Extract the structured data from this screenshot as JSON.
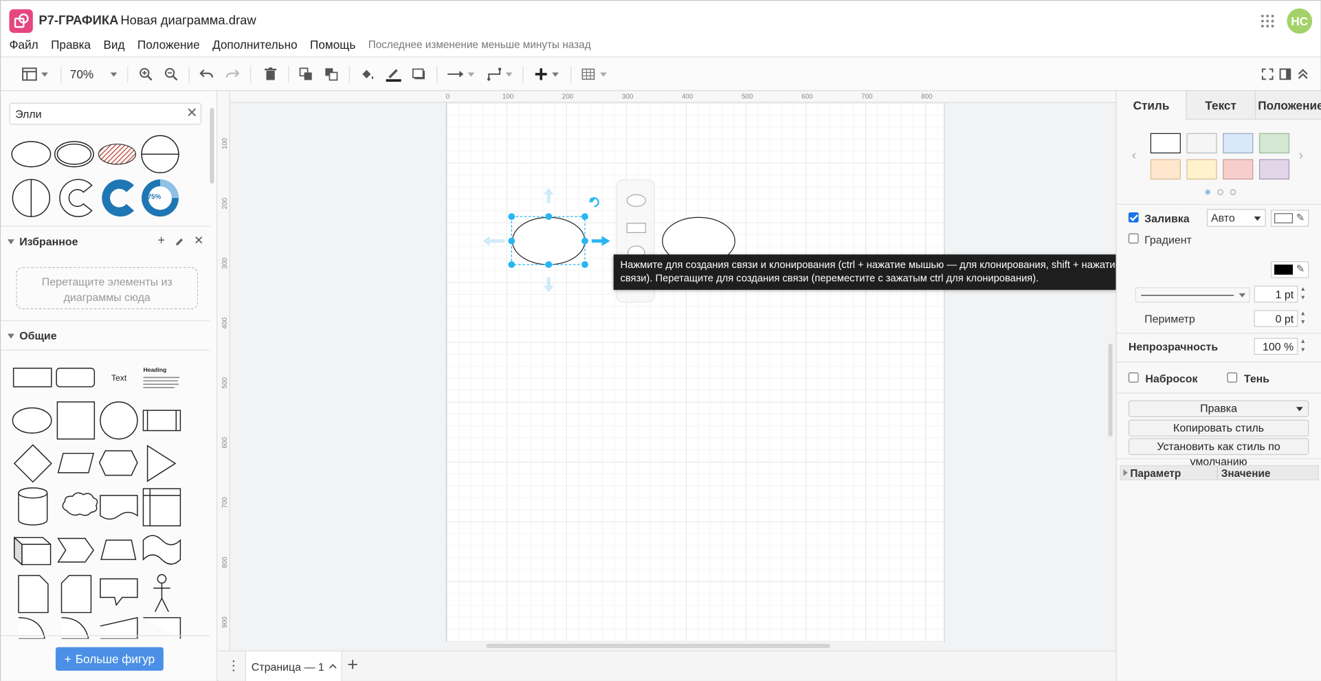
{
  "app": {
    "name": "Р7-ГРАФИКА",
    "document_title": "Новая диаграмма.draw",
    "avatar_initials": "НС",
    "logo_color": "#e6457f",
    "avatar_color": "#a4d26a"
  },
  "menu": {
    "items": [
      "Файл",
      "Правка",
      "Вид",
      "Положение",
      "Дополнительно",
      "Помощь"
    ],
    "last_change": "Последнее изменение меньше минуты назад"
  },
  "toolbar": {
    "zoom": "70%",
    "icons": [
      "panel-layout-icon",
      "zoom-in-icon",
      "zoom-out-icon",
      "undo-icon",
      "redo-icon",
      "delete-icon",
      "to-front-icon",
      "to-back-icon",
      "fill-color-icon",
      "line-color-icon",
      "shadow-icon",
      "connection-icon",
      "waypoints-icon",
      "insert-icon",
      "table-icon",
      "fullscreen-icon",
      "format-panel-icon",
      "collapse-icon"
    ]
  },
  "left": {
    "search_value": "Элли",
    "favorites_title": "Избранное",
    "favorites_drop": "Перетащите элементы из диаграммы сюда",
    "general_title": "Общие",
    "shape_text": "Text",
    "shape_heading": "Heading",
    "donut_label": "75%",
    "more_shapes": "Больше фигур"
  },
  "canvas": {
    "ruler_top": [
      "0",
      "100",
      "200",
      "300",
      "400",
      "500",
      "600",
      "700",
      "800"
    ],
    "ruler_left": [
      "100",
      "200",
      "300",
      "400",
      "500",
      "600",
      "700",
      "800",
      "900"
    ],
    "tooltip": "Нажмите для создания связи и клонирования (ctrl + нажатие мышью — для клонирования, shift + нажатие мышью — для создания связи). Перетащите для создания связи (переместите с зажатым ctrl для клонирования).",
    "selection_color": "#29b6f2"
  },
  "bottom": {
    "page_tab": "Страница — 1"
  },
  "right": {
    "tabs": [
      "Стиль",
      "Текст",
      "Положение"
    ],
    "swatches": [
      "#ffffff",
      "#f5f5f5",
      "#dae8fc",
      "#d5e8d4",
      "#ffe6cc",
      "#fff2cc",
      "#f8cecc",
      "#e1d5e7"
    ],
    "fill_label": "Заливка",
    "fill_mode": "Авто",
    "gradient_label": "Градиент",
    "line_width": "1 pt",
    "perimeter_label": "Периметр",
    "perimeter_value": "0 pt",
    "opacity_label": "Непрозрачность",
    "opacity_value": "100 %",
    "sketch_label": "Набросок",
    "shadow_label": "Тень",
    "edit_select": "Правка",
    "copy_style": "Копировать стиль",
    "set_default": "Установить как стиль по умолчанию",
    "param_header": "Параметр",
    "value_header": "Значение"
  }
}
